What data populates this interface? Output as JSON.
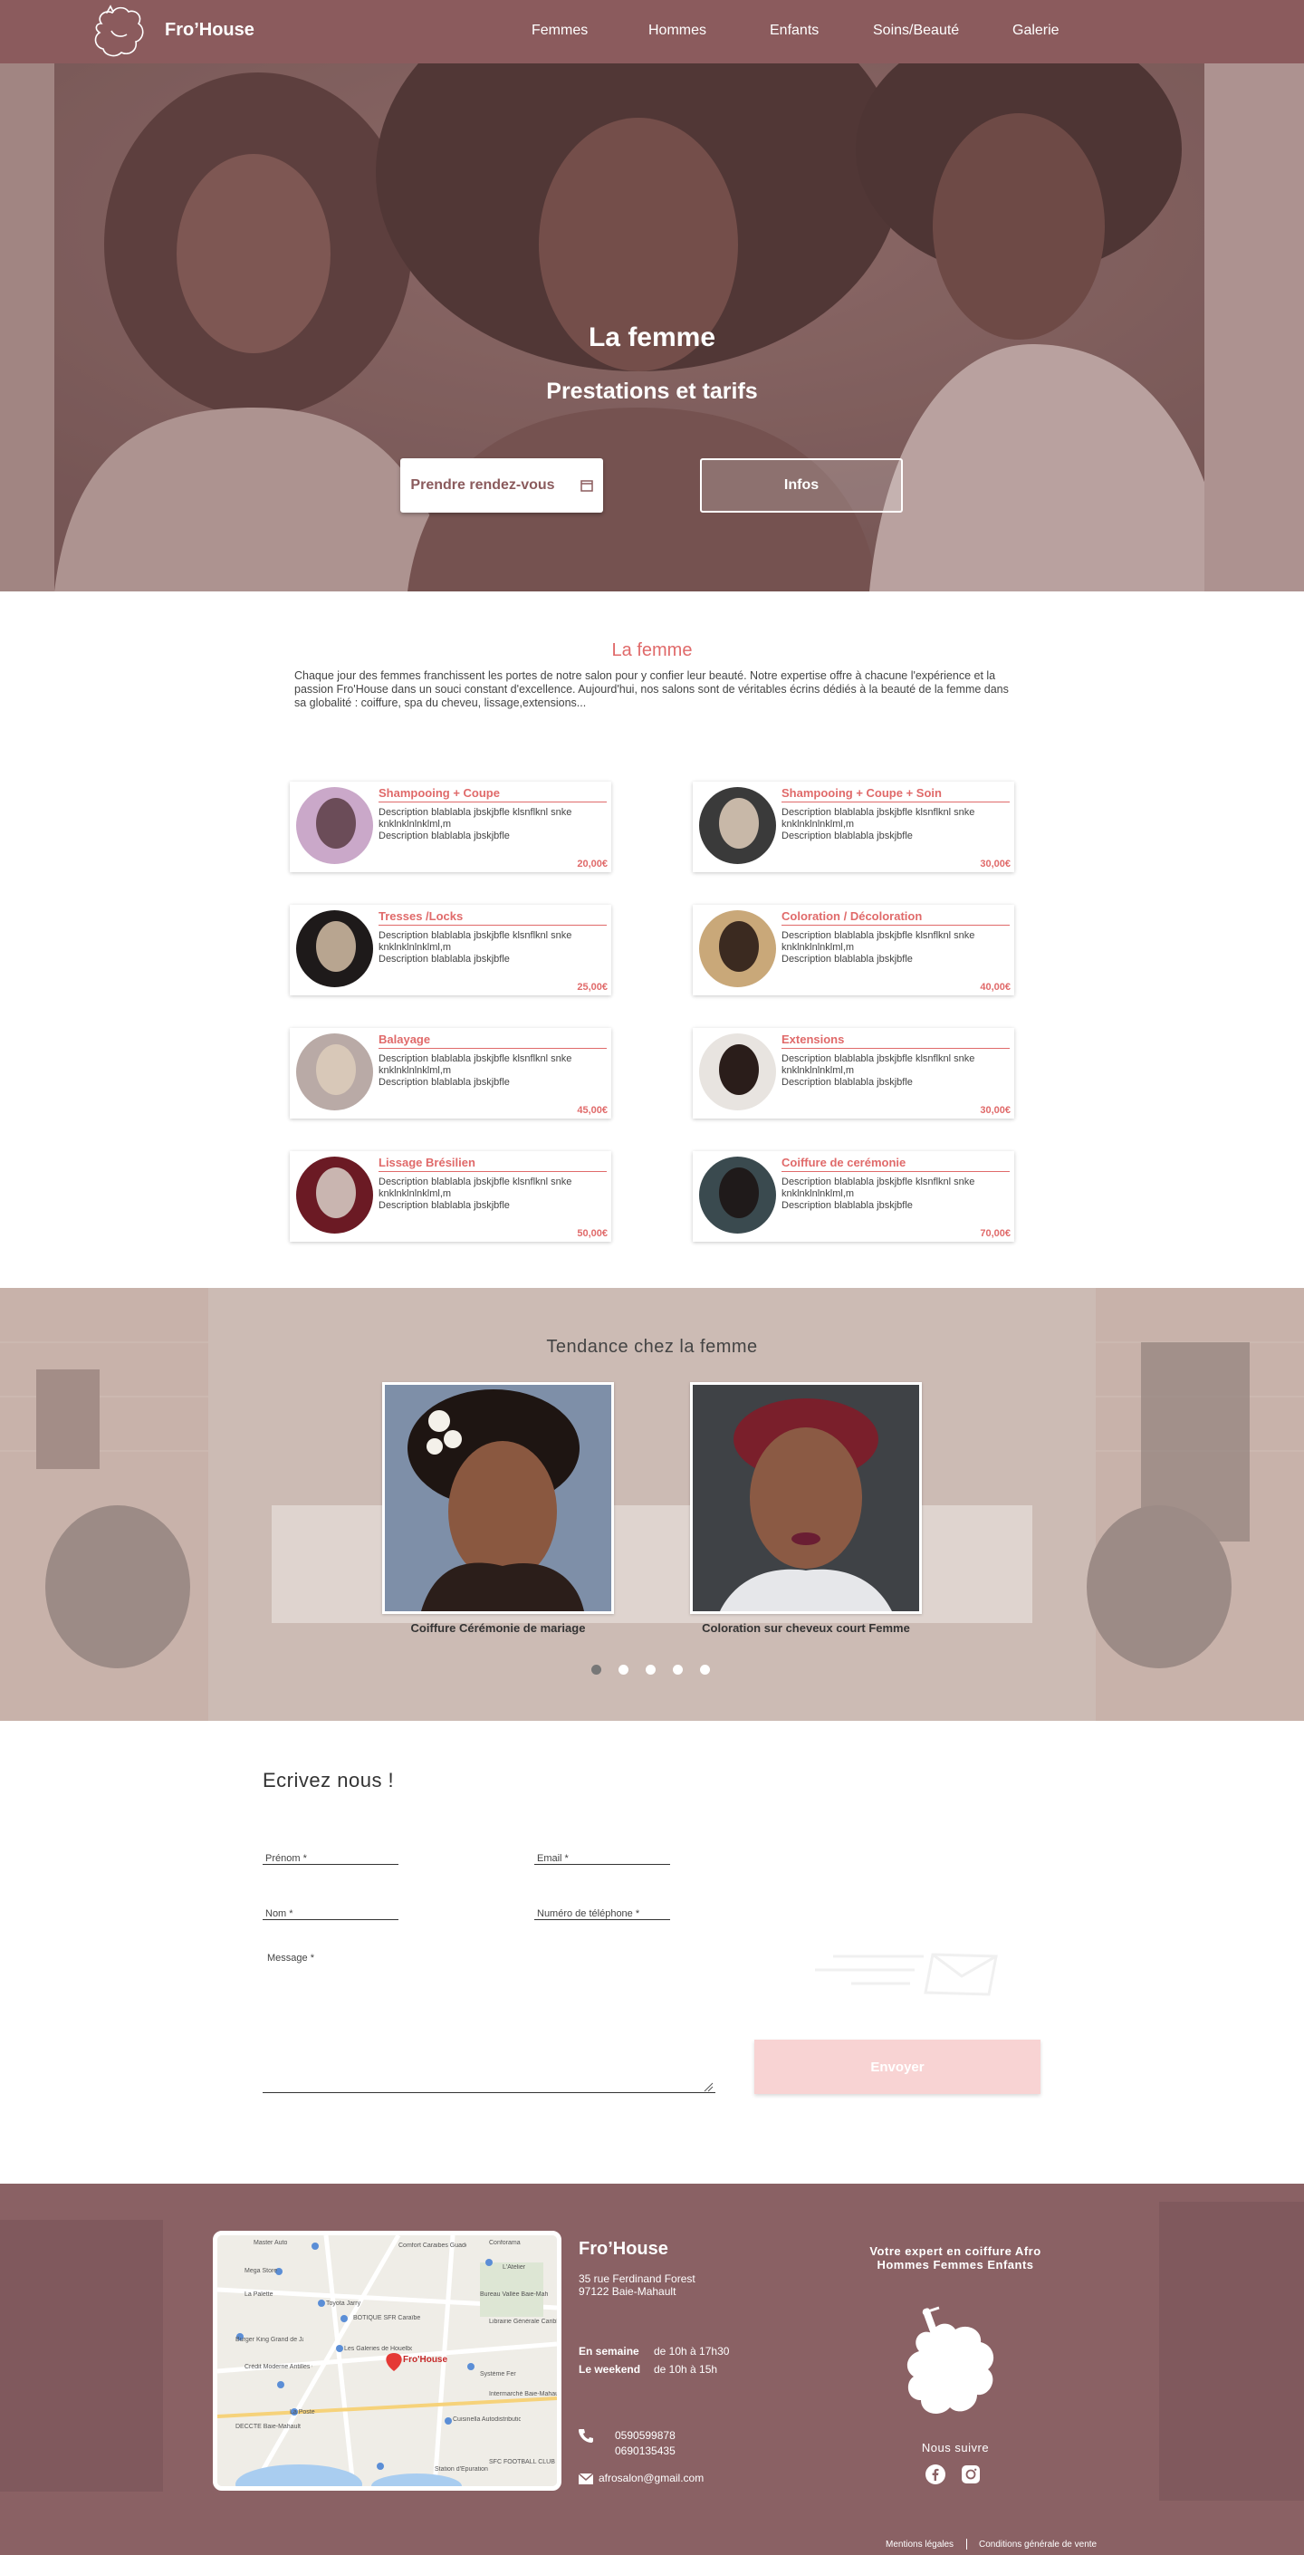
{
  "header": {
    "brand": "Fro’House",
    "nav": [
      "Femmes",
      "Hommes",
      "Enfants",
      "Soins/Beauté",
      "Galerie"
    ]
  },
  "hero": {
    "title": "La femme",
    "subtitle": "Prestations et tarifs",
    "btn_rdv": "Prendre rendez-vous",
    "btn_infos": "Infos"
  },
  "intro": {
    "title": "La femme",
    "text": "Chaque jour des femmes franchissent les portes de notre salon pour y confier leur beauté. Notre expertise offre à chacune l'expérience et la passion Fro'House dans un souci constant d'excellence. Aujourd'hui, nos salons sont de véritables écrins dédiés à la beauté de la femme dans sa globalité : coiffure, spa du cheveu, lissage,extensions..."
  },
  "services": [
    {
      "title": "Shampooing + Coupe",
      "desc1": "Description blablabla jbskjbfle klsnflknl snke knklnklnlnklml,m",
      "desc2": "Description blablabla jbskjbfle",
      "price": "20,00€"
    },
    {
      "title": "Shampooing + Coupe + Soin",
      "desc1": "Description blablabla jbskjbfle klsnflknl snke knklnklnlnklml,m",
      "desc2": "Description blablabla jbskjbfle",
      "price": "30,00€"
    },
    {
      "title": "Tresses /Locks",
      "desc1": "Description blablabla jbskjbfle klsnflknl snke knklnklnlnklml,m",
      "desc2": "Description blablabla jbskjbfle",
      "price": "25,00€"
    },
    {
      "title": "Coloration / Décoloration",
      "desc1": "Description blablabla jbskjbfle klsnflknl snke knklnklnlnklml,m",
      "desc2": "Description blablabla jbskjbfle",
      "price": "40,00€"
    },
    {
      "title": "Balayage",
      "desc1": "Description blablabla jbskjbfle klsnflknl snke knklnklnlnklml,m",
      "desc2": "Description blablabla jbskjbfle",
      "price": "45,00€"
    },
    {
      "title": "Extensions",
      "desc1": "Description blablabla jbskjbfle klsnflknl snke knklnklnlnklml,m",
      "desc2": "Description blablabla jbskjbfle",
      "price": "30,00€"
    },
    {
      "title": "Lissage Brésilien",
      "desc1": "Description blablabla jbskjbfle klsnflknl snke knklnklnlnklml,m",
      "desc2": "Description blablabla jbskjbfle",
      "price": "50,00€"
    },
    {
      "title": "Coiffure de cerémonie",
      "desc1": "Description blablabla jbskjbfle klsnflknl snke knklnklnlnklml,m",
      "desc2": "Description blablabla jbskjbfle",
      "price": "70,00€"
    }
  ],
  "trend": {
    "title": "Tendance chez la femme",
    "captions": [
      "Coiffure Cérémonie de mariage",
      "Coloration sur cheveux court Femme"
    ]
  },
  "contact": {
    "title": "Ecrivez nous !",
    "prenom": "Prénom *",
    "email": "Email *",
    "nom": "Nom *",
    "tel": "Numéro de téléphone *",
    "message": "Message *",
    "send": "Envoyer"
  },
  "footer": {
    "name": "Fro’House",
    "addr1": "35 rue Ferdinand Forest",
    "addr2": "97122 Baie-Mahault",
    "week_label": "En semaine",
    "week_hours": "de 10h à 17h30",
    "weekend_label": "Le weekend",
    "weekend_hours": "de 10h à 15h",
    "phone1": "0590599878",
    "phone2": "0690135435",
    "email": "afrosalon@gmail.com",
    "tagline1": "Votre expert en coiffure Afro",
    "tagline2": "Hommes Femmes Enfants",
    "follow": "Nous suivre",
    "legal1": "Mentions légales",
    "legal2": "Conditions générale de vente",
    "map_pin": "Fro'House",
    "map_labels": [
      "Conforama",
      "Comfort Caraibes Guadeloupe",
      "Master Auto",
      "Mega Store",
      "L'Atelier",
      "La Palette",
      "Toyota Jarry",
      "Bureau Vallée Baie-Mahault",
      "BOTIQUE SFR Caraïbe Bergevin",
      "Librairie Générale Caribbean Culture House",
      "Burger King Grand de Jarry",
      "Les Galeries de Houelbourg",
      "Système Fer",
      "Crédit Moderne Antilles Guyane",
      "Intermarché Baie-Mahault",
      "Cuisinella Autodistribution",
      "La Poste",
      "DECCTE Baie-Mahault",
      "SFC FOOTBALL CLUB",
      "Station d'Épuration"
    ]
  },
  "colors": {
    "brand": "#8b5b5d",
    "accent": "#e06a6a",
    "send_btn": "#f8d3d3"
  }
}
